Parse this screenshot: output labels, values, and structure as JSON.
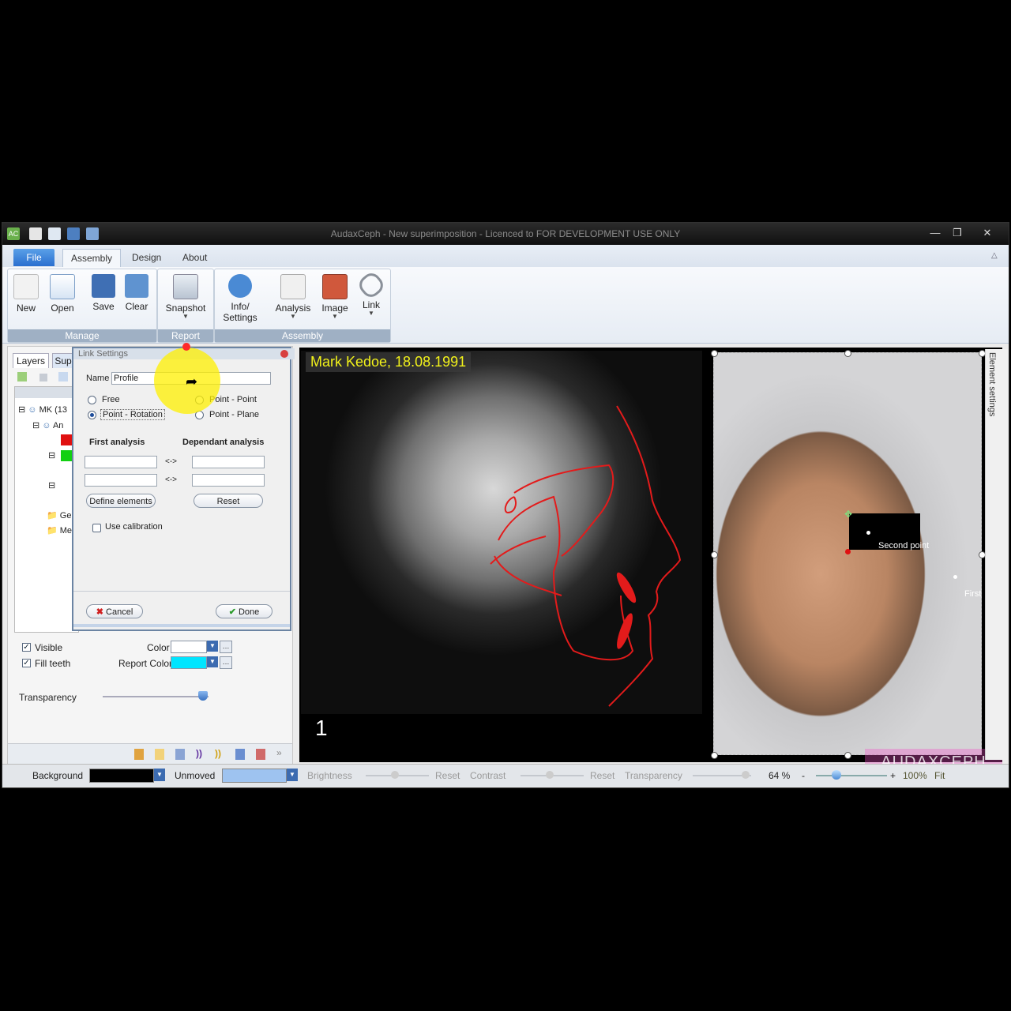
{
  "window": {
    "title": "AudaxCeph - New superimposition - Licenced to FOR DEVELOPMENT USE ONLY",
    "app_icon": "AC",
    "controls": [
      "minimize-icon",
      "maximize-icon",
      "close-icon"
    ]
  },
  "ribbon": {
    "tabs": [
      "File",
      "Assembly",
      "Design",
      "About"
    ],
    "active_tab": "Assembly",
    "groups": [
      {
        "caption": "Manage",
        "buttons": [
          "New",
          "Open",
          "Save",
          "Clear"
        ]
      },
      {
        "caption": "Report",
        "buttons": [
          "Snapshot"
        ]
      },
      {
        "caption": "Assembly",
        "buttons": [
          "Info/\nSettings",
          "Analysis",
          "Image",
          "Link"
        ]
      }
    ]
  },
  "left_panel": {
    "tabs": [
      "Layers",
      "Sup"
    ],
    "tree": [
      "MK (13",
      "An",
      "Ge",
      "Me"
    ],
    "visible_label": "Visible",
    "fill_teeth_label": "Fill teeth",
    "color_label": "Color",
    "report_color_label": "Report Color",
    "transparency_label": "Transparency",
    "transparency_value": 0.95,
    "color_value": "#ffffff",
    "report_color_value": "#00e5ff"
  },
  "dialog": {
    "title": "Link Settings",
    "name_label": "Name",
    "name_value": "Profile",
    "options": {
      "free": "Free",
      "point_point": "Point - Point",
      "point_rotation": "Point - Rotation",
      "point_plane": "Point - Plane"
    },
    "selected_option": "Point - Rotation",
    "first_analysis": "First analysis",
    "dependant_analysis": "Dependant analysis",
    "arrow": "<->",
    "define_elements": "Define elements",
    "reset": "Reset",
    "use_calibration": "Use calibration",
    "cancel": "Cancel",
    "done": "Done"
  },
  "canvas": {
    "xray_caption": "Mark Kedoe, 18.08.1991",
    "xray_number": "1",
    "second_point": "Second point",
    "first_point": "First",
    "element_settings": "Element settings",
    "watermark": "AUDAXCEPH"
  },
  "status": {
    "background_label": "Background",
    "unmoved_label": "Unmoved",
    "brightness": "Brightness",
    "contrast": "Contrast",
    "transparency": "Transparency",
    "reset": "Reset",
    "zoom": "64 %",
    "minus": "-",
    "plus": "+",
    "hundred": "100%",
    "fit": "Fit",
    "colors": {
      "background": "#000000",
      "unmoved": "#9ec3f0",
      "overlay_trace": "#e31b1b",
      "caption_yellow": "#f2f21a"
    }
  }
}
